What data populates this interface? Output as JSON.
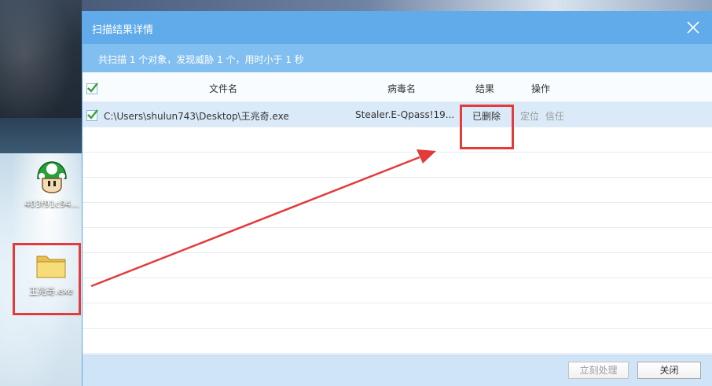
{
  "desktop": {
    "icons": [
      {
        "label": "403f91c94..."
      },
      {
        "label": "王兆奇.exe"
      }
    ]
  },
  "dialog": {
    "title": "扫描结果详情",
    "summary": "共扫描 1 个对象，发现威胁 1 个，用时小于 1 秒",
    "columns": {
      "file": "文件名",
      "virus": "病毒名",
      "result": "结果",
      "action": "操作"
    },
    "rows": [
      {
        "file": "C:\\Users\\shulun743\\Desktop\\王兆奇.exe",
        "virus": "Stealer.E-Qpass!19...",
        "result": "已删除",
        "action_locate": "定位",
        "action_trust": "信任"
      }
    ],
    "buttons": {
      "process": "立刻处理",
      "close": "关闭"
    }
  },
  "colors": {
    "titlebar": "#61abeb",
    "summary_bar": "#82bff1",
    "selected_row": "#dbeaf8",
    "annotation_red": "#e33b3b"
  }
}
